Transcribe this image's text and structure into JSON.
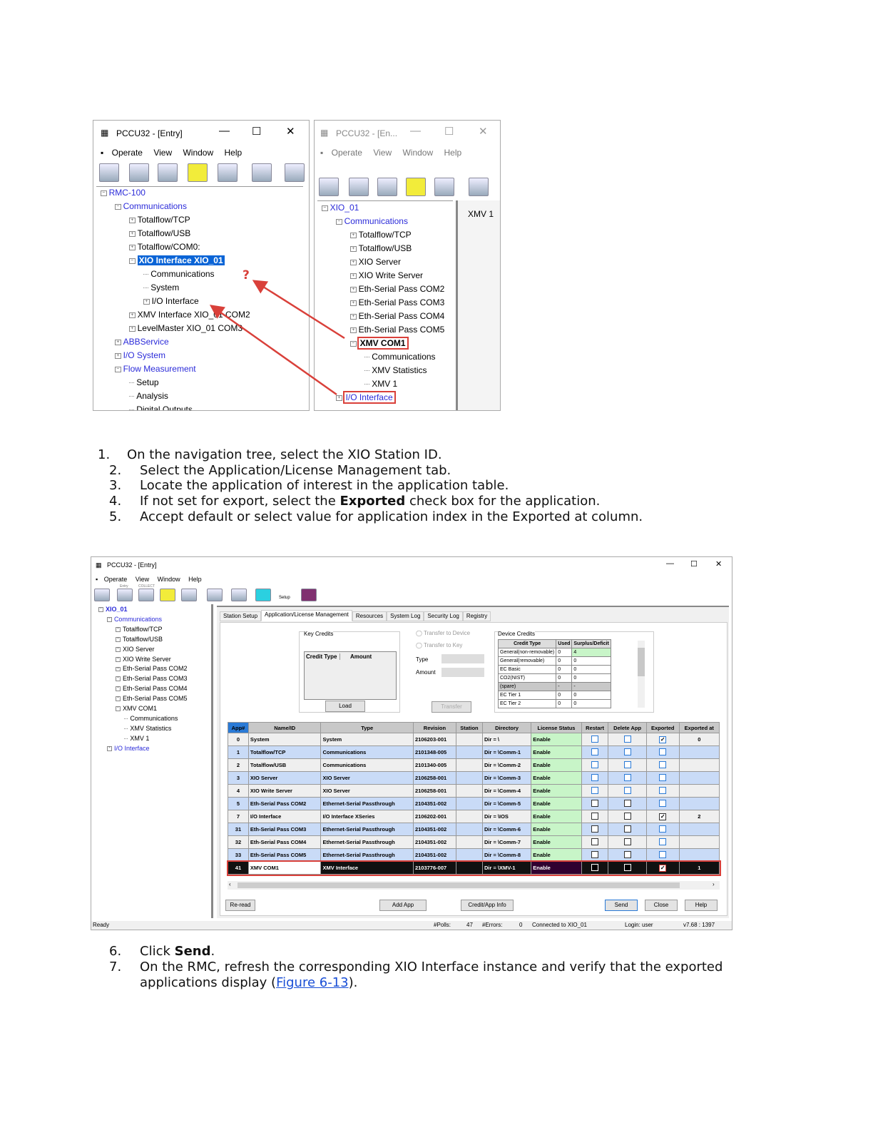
{
  "figure_top": {
    "left_window": {
      "title": "PCCU32 - [Entry]",
      "menu": [
        "Operate",
        "View",
        "Window",
        "Help"
      ],
      "tree": [
        {
          "label": "RMC-100",
          "level": 0,
          "box": "-",
          "style": "blue"
        },
        {
          "label": "Communications",
          "level": 1,
          "box": "-",
          "style": "blue"
        },
        {
          "label": "Totalflow/TCP",
          "level": 2,
          "box": "+"
        },
        {
          "label": "Totalflow/USB",
          "level": 2,
          "box": "+"
        },
        {
          "label": "Totalflow/COM0:",
          "level": 2,
          "box": "+"
        },
        {
          "label": "XIO Interface XIO_01",
          "level": 2,
          "box": "-",
          "style": "sel"
        },
        {
          "label": "Communications",
          "level": 3,
          "box": ""
        },
        {
          "label": "System",
          "level": 3,
          "box": ""
        },
        {
          "label": "I/O Interface",
          "level": 3,
          "box": "+"
        },
        {
          "label": "XMV Interface XIO_01 COM2",
          "level": 2,
          "box": "+"
        },
        {
          "label": "LevelMaster XIO_01 COM3",
          "level": 2,
          "box": "+"
        },
        {
          "label": "ABBService",
          "level": 1,
          "box": "+",
          "style": "blue"
        },
        {
          "label": "I/O System",
          "level": 1,
          "box": "+",
          "style": "blue"
        },
        {
          "label": "Flow Measurement",
          "level": 1,
          "box": "-",
          "style": "blue"
        },
        {
          "label": "Setup",
          "level": 2,
          "box": ""
        },
        {
          "label": "Analysis",
          "level": 2,
          "box": ""
        },
        {
          "label": "Digital Outputs",
          "level": 2,
          "box": ""
        }
      ],
      "annotation": "?"
    },
    "right_window": {
      "title": "PCCU32 - [En...",
      "menu": [
        "Operate",
        "View",
        "Window",
        "Help"
      ],
      "tab": "XMV 1",
      "tree": [
        {
          "label": "XIO_01",
          "level": 0,
          "box": "-",
          "style": "blue"
        },
        {
          "label": "Communications",
          "level": 1,
          "box": "-",
          "style": "blue"
        },
        {
          "label": "Totalflow/TCP",
          "level": 2,
          "box": "+"
        },
        {
          "label": "Totalflow/USB",
          "level": 2,
          "box": "+"
        },
        {
          "label": "XIO Server",
          "level": 2,
          "box": "+"
        },
        {
          "label": "XIO Write Server",
          "level": 2,
          "box": "+"
        },
        {
          "label": "Eth-Serial Pass COM2",
          "level": 2,
          "box": "+"
        },
        {
          "label": "Eth-Serial Pass COM3",
          "level": 2,
          "box": "+"
        },
        {
          "label": "Eth-Serial Pass COM4",
          "level": 2,
          "box": "+"
        },
        {
          "label": "Eth-Serial Pass COM5",
          "level": 2,
          "box": "+"
        },
        {
          "label": "XMV COM1",
          "level": 2,
          "box": "-",
          "style": "redbold"
        },
        {
          "label": "Communications",
          "level": 3,
          "box": ""
        },
        {
          "label": "XMV Statistics",
          "level": 3,
          "box": ""
        },
        {
          "label": "XMV 1",
          "level": 3,
          "box": ""
        },
        {
          "label": "I/O Interface",
          "level": 1,
          "box": "+",
          "style": "redblue"
        }
      ]
    }
  },
  "steps_a": [
    {
      "num": "1.",
      "text": "On the navigation tree, select the XIO Station ID."
    },
    {
      "num": "2.",
      "text": "Select the Application/License Management tab."
    },
    {
      "num": "3.",
      "text": "Locate the application of interest in the application table."
    },
    {
      "num": "4.",
      "pre": "If not set for export, select the ",
      "bold": "Exported",
      "post": " check box for the application."
    },
    {
      "num": "5.",
      "text": "Accept default or select value for application index in the Exported at column."
    }
  ],
  "figure_bottom": {
    "title": "PCCU32 - [Entry]",
    "menu": [
      "Operate",
      "View",
      "Window",
      "Help"
    ],
    "toolbar_labels": {
      "entry": "Entry",
      "collect": "COLLECT",
      "setup": "Setup"
    },
    "tree": [
      {
        "label": "XIO_01",
        "level": 0,
        "box": "-",
        "style": "bluebold"
      },
      {
        "label": "Communications",
        "level": 1,
        "box": "-",
        "style": "blue"
      },
      {
        "label": "Totalflow/TCP",
        "level": 2,
        "box": "+"
      },
      {
        "label": "Totalflow/USB",
        "level": 2,
        "box": "+"
      },
      {
        "label": "XIO Server",
        "level": 2,
        "box": "+"
      },
      {
        "label": "XIO Write Server",
        "level": 2,
        "box": "+"
      },
      {
        "label": "Eth-Serial Pass COM2",
        "level": 2,
        "box": "+"
      },
      {
        "label": "Eth-Serial Pass COM3",
        "level": 2,
        "box": "+"
      },
      {
        "label": "Eth-Serial Pass COM4",
        "level": 2,
        "box": "+"
      },
      {
        "label": "Eth-Serial Pass COM5",
        "level": 2,
        "box": "+"
      },
      {
        "label": "XMV COM1",
        "level": 2,
        "box": "-"
      },
      {
        "label": "Communications",
        "level": 3,
        "box": ""
      },
      {
        "label": "XMV Statistics",
        "level": 3,
        "box": ""
      },
      {
        "label": "XMV 1",
        "level": 3,
        "box": ""
      },
      {
        "label": "I/O Interface",
        "level": 1,
        "box": "+",
        "style": "blue"
      }
    ],
    "tabs": [
      "Station Setup",
      "Application/License Management",
      "Resources",
      "System Log",
      "Security Log",
      "Registry"
    ],
    "active_tab": "Application/License Management",
    "key_credits": {
      "legend": "Key Credits",
      "columns": [
        "Credit Type",
        "Amount"
      ],
      "load": "Load"
    },
    "transfer": {
      "to_device": "Transfer to Device",
      "to_key": "Transfer to Key",
      "type_label": "Type",
      "amount_label": "Amount",
      "button": "Transfer"
    },
    "device_credits": {
      "legend": "Device Credits",
      "columns": [
        "Credit Type",
        "Used",
        "Surplus/Deficit"
      ],
      "rows": [
        [
          "General(non-removable)",
          "0",
          "4"
        ],
        [
          "General(removable)",
          "0",
          "0"
        ],
        [
          "EC Basic",
          "0",
          "0"
        ],
        [
          "CO2(NIST)",
          "0",
          "0"
        ],
        [
          "(spare)",
          "-",
          "-"
        ],
        [
          "EC Tier 1",
          "0",
          "0"
        ],
        [
          "EC Tier 2",
          "0",
          "0"
        ]
      ]
    },
    "app_table": {
      "columns": [
        "App#",
        "Name/ID",
        "Type",
        "Revision",
        "Station",
        "Directory",
        "License Status",
        "Restart",
        "Delete App",
        "Exported",
        "Exported at"
      ],
      "rows": [
        {
          "app": "0",
          "name": "System",
          "type": "System",
          "rev": "2106203-001",
          "station": "",
          "dir": "Dir = \\",
          "lic": "Enable",
          "restart": false,
          "delete": false,
          "exported": true,
          "at": "0"
        },
        {
          "app": "1",
          "name": "Totalflow/TCP",
          "type": "Communications",
          "rev": "2101348-005",
          "station": "",
          "dir": "Dir = \\Comm-1",
          "lic": "Enable",
          "restart": false,
          "delete": false,
          "exported": false,
          "at": ""
        },
        {
          "app": "2",
          "name": "Totalflow/USB",
          "type": "Communications",
          "rev": "2101340-005",
          "station": "",
          "dir": "Dir = \\Comm-2",
          "lic": "Enable",
          "restart": false,
          "delete": false,
          "exported": false,
          "at": ""
        },
        {
          "app": "3",
          "name": "XIO Server",
          "type": "XIO Server",
          "rev": "2106258-001",
          "station": "",
          "dir": "Dir = \\Comm-3",
          "lic": "Enable",
          "restart": false,
          "delete": false,
          "exported": false,
          "at": ""
        },
        {
          "app": "4",
          "name": "XIO Write Server",
          "type": "XIO Server",
          "rev": "2106258-001",
          "station": "",
          "dir": "Dir = \\Comm-4",
          "lic": "Enable",
          "restart": false,
          "delete": false,
          "exported": false,
          "at": ""
        },
        {
          "app": "5",
          "name": "Eth-Serial Pass COM2",
          "type": "Ethernet-Serial Passthrough",
          "rev": "2104351-002",
          "station": "",
          "dir": "Dir = \\Comm-5",
          "lic": "Enable",
          "restart": false,
          "delete": false,
          "exported": false,
          "at": ""
        },
        {
          "app": "7",
          "name": "I/O Interface",
          "type": "I/O Interface XSeries",
          "rev": "2106202-001",
          "station": "",
          "dir": "Dir = \\IOS",
          "lic": "Enable",
          "restart": false,
          "delete": false,
          "exported": true,
          "at": "2"
        },
        {
          "app": "31",
          "name": "Eth-Serial Pass COM3",
          "type": "Ethernet-Serial Passthrough",
          "rev": "2104351-002",
          "station": "",
          "dir": "Dir = \\Comm-6",
          "lic": "Enable",
          "restart": false,
          "delete": false,
          "exported": false,
          "at": ""
        },
        {
          "app": "32",
          "name": "Eth-Serial Pass COM4",
          "type": "Ethernet-Serial Passthrough",
          "rev": "2104351-002",
          "station": "",
          "dir": "Dir = \\Comm-7",
          "lic": "Enable",
          "restart": false,
          "delete": false,
          "exported": false,
          "at": ""
        },
        {
          "app": "33",
          "name": "Eth-Serial Pass COM5",
          "type": "Ethernet-Serial Passthrough",
          "rev": "2104351-002",
          "station": "",
          "dir": "Dir = \\Comm-8",
          "lic": "Enable",
          "restart": false,
          "delete": false,
          "exported": false,
          "at": ""
        },
        {
          "app": "41",
          "name": "XMV COM1",
          "type": "XMV Interface",
          "rev": "2103776-007",
          "station": "",
          "dir": "Dir = \\XMV-1",
          "lic": "Enable",
          "restart": false,
          "delete": false,
          "exported": true,
          "at": "1",
          "selected": true
        }
      ]
    },
    "buttons": {
      "reread": "Re-read",
      "add_app": "Add App",
      "credit_info": "Credit/App Info",
      "send": "Send",
      "close": "Close",
      "help": "Help"
    },
    "statusbar": {
      "ready": "Ready",
      "polls_label": "#Polls:",
      "polls": "47",
      "errors_label": "#Errors:",
      "errors": "0",
      "connected": "Connected to XIO_01",
      "login": "Login: user",
      "version": "v7.68 : 1397"
    }
  },
  "steps_b": [
    {
      "num": "6.",
      "pre": "Click ",
      "bold": "Send",
      "post": "."
    },
    {
      "num": "7.",
      "text": "On the RMC, refresh the corresponding XIO Interface instance and verify that the exported",
      "text2_pre": "applications display (",
      "link": "Figure 6-13",
      "text2_post": ")."
    }
  ],
  "colors": {
    "highlight": "#0a64d6",
    "annotation_red": "#d9403a",
    "row_blue": "#c9dbf7",
    "row_gray": "#efefef",
    "license_green": "#c8f5c8",
    "link": "#1a4fd6"
  }
}
